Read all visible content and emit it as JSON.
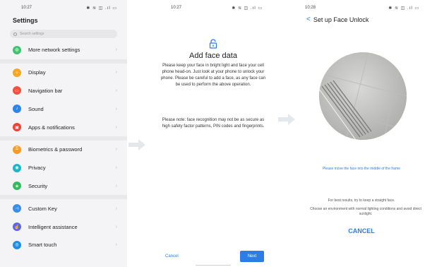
{
  "screen1": {
    "time": "10:27",
    "status_icons": "✱ ≋ ◫ .ıl ▭",
    "title": "Settings",
    "search_placeholder": "Search settings",
    "items": [
      {
        "label": "More network settings",
        "color": "#3ec46d",
        "icon": "globe-icon",
        "glyph": "◍"
      },
      {
        "label": "Display",
        "color": "#f5a623",
        "icon": "display-icon",
        "glyph": "☼"
      },
      {
        "label": "Navigation bar",
        "color": "#f0503c",
        "icon": "navigation-icon",
        "glyph": "▭"
      },
      {
        "label": "Sound",
        "color": "#2e87e8",
        "icon": "sound-icon",
        "glyph": "♪"
      },
      {
        "label": "Apps & notifications",
        "color": "#ef4136",
        "icon": "apps-icon",
        "glyph": "▣"
      },
      {
        "label": "Biometrics & password",
        "color": "#f59a23",
        "icon": "key-icon",
        "glyph": "⚿"
      },
      {
        "label": "Privacy",
        "color": "#1fb5c9",
        "icon": "privacy-icon",
        "glyph": "◉"
      },
      {
        "label": "Security",
        "color": "#37b95e",
        "icon": "shield-icon",
        "glyph": "◈"
      },
      {
        "label": "Custom Key",
        "color": "#3a8ee8",
        "icon": "custom-key-icon",
        "glyph": "⊣"
      },
      {
        "label": "Intelligent assistance",
        "color": "#5b67e8",
        "icon": "assistant-icon",
        "glyph": "☝"
      },
      {
        "label": "Smart touch",
        "color": "#1c8fe0",
        "icon": "smart-touch-icon",
        "glyph": "◎"
      }
    ]
  },
  "screen2": {
    "time": "10:27",
    "status_icons": "✱ ≋ ◫ .ıl ▭",
    "title": "Add face data",
    "body": "Please keep your face in bright light and face your cell phone head-on. Just look at your phone to unlock your phone. Please be careful to add a face, as any face can be used to perform the above operation.",
    "note": "Please note: face recognition may not be as secure as high safety factor patterns, PIN codes and fingerprints.",
    "cancel_label": "Cancel",
    "next_label": "Next"
  },
  "screen3": {
    "time": "10:28",
    "status_icons": "✱ ≋ ◫ .ıl ▭",
    "back_glyph": "<",
    "title": "Set up Face Unlock",
    "hint": "Please move the face into the middle of the frame",
    "tip1": "For best results, try to keep a straight face.",
    "tip2": "Choose an environment with normal lighting conditions and avoid direct sunlight.",
    "cancel_label": "CANCEL"
  },
  "accent": "#2c7de6"
}
